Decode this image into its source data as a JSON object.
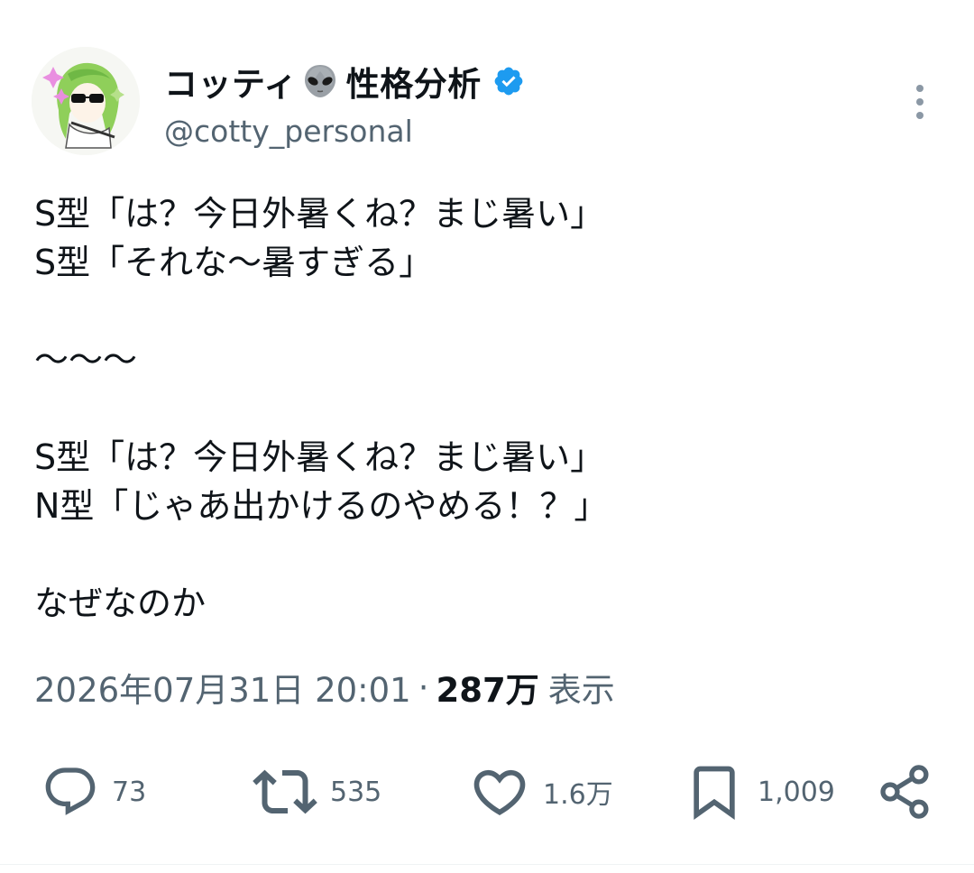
{
  "author": {
    "display_name": "コッティ",
    "name_suffix": "性格分析",
    "handle": "@cotty_personal",
    "verified": true,
    "name_emoji": "alien-icon"
  },
  "tweet": {
    "lines": [
      "S型「は？今日外暑くね？まじ暑い」",
      "S型「それな〜暑すぎる」",
      "",
      "〜〜〜",
      "",
      "S型「は？今日外暑くね？まじ暑い」",
      "N型「じゃあ出かけるのやめる！？」",
      "",
      "なぜなのか"
    ],
    "timestamp": "2026年07月31日 20:01",
    "separator": "·",
    "views_count": "287万",
    "views_label": "表示"
  },
  "actions": {
    "replies": "73",
    "retweets": "535",
    "likes": "1.6万",
    "bookmarks": "1,009"
  },
  "colors": {
    "text_primary": "#0f1419",
    "text_secondary": "#536471",
    "verified_blue": "#1d9bf0",
    "icon_gray": "#536471"
  }
}
